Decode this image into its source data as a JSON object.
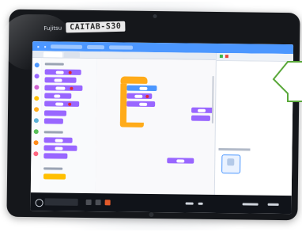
{
  "device_label": {
    "prefix": "Fujitsu",
    "tag": "CAITAB-S30"
  },
  "colors": {
    "scratch_blue": "#4c97ff",
    "looks_purple": "#9966ff",
    "events_yellow": "#ffbf00",
    "control_orange": "#ffab19",
    "motion_blue": "#4c97ff",
    "red_marker": "#e0262f",
    "callout_border": "#5aa83a"
  },
  "icons": {
    "start": "windows-start-icon",
    "search": "search-icon",
    "flag": "green-flag-icon",
    "stop": "stop-icon",
    "callout": "speech-callout-icon"
  }
}
